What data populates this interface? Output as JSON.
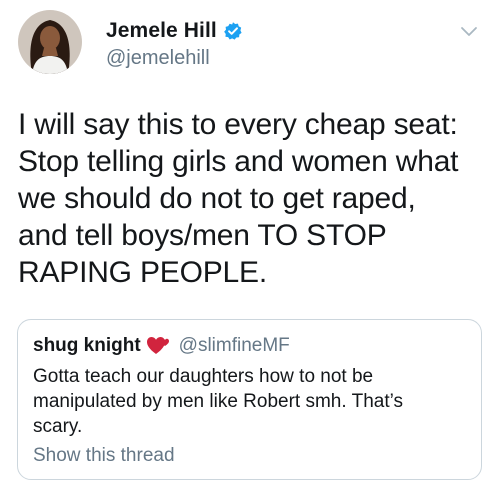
{
  "author": {
    "display_name": "Jemele Hill",
    "handle": "@jemelehill",
    "verified": true,
    "avatar_icon": "profile-photo"
  },
  "tweet": {
    "lines": [
      "I will say this to every cheap seat:",
      "Stop telling girls and women what",
      "we should do not to get raped,",
      "and tell boys/men TO STOP",
      "RAPING PEOPLE."
    ]
  },
  "quoted_tweet": {
    "display_name": "shug knight",
    "emoji_icon": "two-hearts-icon",
    "handle": "@slimfineMF",
    "lines": [
      "Gotta teach our daughters how to not be",
      "manipulated by men like Robert smh. That’s",
      "scary."
    ],
    "show_thread_label": "Show this thread"
  },
  "colors": {
    "verified_blue": "#1da1f2",
    "secondary_text": "#657786",
    "border": "#ccd6dd",
    "heart_red": "#d1243e"
  }
}
